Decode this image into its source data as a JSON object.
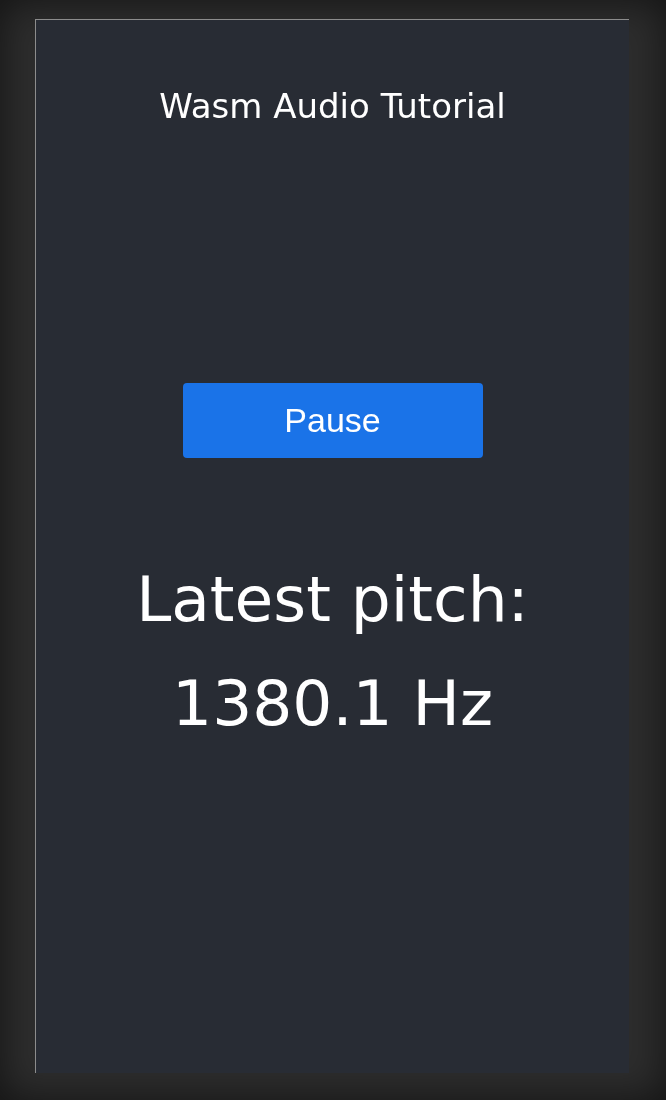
{
  "app": {
    "title": "Wasm Audio Tutorial"
  },
  "button": {
    "label": "Pause"
  },
  "pitch": {
    "label": "Latest pitch:",
    "value": "1380.1 Hz"
  }
}
